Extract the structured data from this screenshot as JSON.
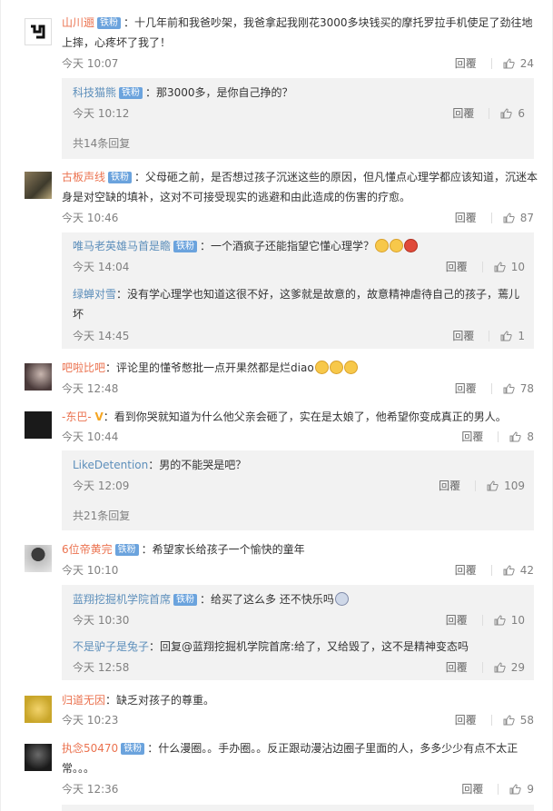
{
  "comments": [
    {
      "name": "山川逦",
      "badge": "铁粉",
      "text": "：十几年前和我爸吵架，我爸拿起我刚花3000多块钱买的摩托罗拉手机使足了劲往地上摔，心疼坏了我了！",
      "time": "今天 10:07",
      "reply_label": "回覆",
      "likes": "24",
      "replies": [
        {
          "name": "科技猫熊",
          "badge": "铁粉",
          "text": "：那3000多，是你自己挣的？",
          "time": "今天 10:12",
          "reply_label": "回覆",
          "likes": "6"
        }
      ],
      "more": "共14条回复"
    },
    {
      "name": "古板声线",
      "badge": "铁粉",
      "text": "：父母砸之前，是否想过孩子沉迷这些的原因，但凡懂点心理学都应该知道，沉迷本身是对空缺的填补，这对不可接受现实的逃避和由此造成的伤害的疗愈。",
      "time": "今天 10:46",
      "reply_label": "回覆",
      "likes": "87",
      "replies": [
        {
          "name": "唯马老英雄马首是瞻",
          "badge": "铁粉",
          "text": "：一个酒疯子还能指望它懂心理学？",
          "time": "今天 14:04",
          "reply_label": "回覆",
          "likes": "10"
        },
        {
          "name": "绿蝉对雪",
          "badge": "",
          "text": "：没有学心理学也知道这很不好，这爹就是故意的，故意精神虐待自己的孩子，蔫儿坏",
          "time": "今天 14:45",
          "reply_label": "回覆",
          "likes": "1"
        }
      ],
      "more": ""
    },
    {
      "name": "吧啦比吧",
      "badge": "",
      "text": "：评论里的懂爷憋批一点开果然都是烂diao",
      "time": "今天 12:48",
      "reply_label": "回覆",
      "likes": "78",
      "replies": [],
      "more": ""
    },
    {
      "name": "-东巴-",
      "badge": "V",
      "text": "：看到你哭就知道为什么他父亲会砸了，实在是太娘了，他希望你变成真正的男人。",
      "time": "今天 10:44",
      "reply_label": "回覆",
      "likes": "8",
      "replies": [
        {
          "name": "LikeDetention",
          "badge": "",
          "text": "：男的不能哭是吧？",
          "time": "今天 12:09",
          "reply_label": "回覆",
          "likes": "109"
        }
      ],
      "more": "共21条回复"
    },
    {
      "name": "6位帝黄完",
      "badge": "铁粉",
      "text": "：希望家长给孩子一个愉快的童年",
      "time": "今天 10:10",
      "reply_label": "回覆",
      "likes": "42",
      "replies": [
        {
          "name": "蓝翔挖掘机学院首席",
          "badge": "铁粉",
          "text": "：给买了这么多 还不快乐吗",
          "time": "今天 10:30",
          "reply_label": "回覆",
          "likes": "10"
        },
        {
          "name": "不是驴子是兔子",
          "badge": "",
          "text": "：回复@蓝翔挖掘机学院首席:给了，又给毁了，这不是精神变态吗",
          "time": "今天 12:58",
          "reply_label": "回覆",
          "likes": "29"
        }
      ],
      "more": ""
    },
    {
      "name": "归道无因",
      "badge": "",
      "text": "：缺乏对孩子的尊重。",
      "time": "今天 10:23",
      "reply_label": "回覆",
      "likes": "58",
      "replies": [],
      "more": ""
    },
    {
      "name": "执念50470",
      "badge": "铁粉",
      "text": "：什么漫圈。。手办圈。。反正跟动漫沾边圈子里面的人，多多少少有点不太正常。。。",
      "time": "今天 12:36",
      "reply_label": "回覆",
      "likes": "9",
      "replies": [],
      "more": ""
    }
  ],
  "colors": {
    "username": "#eb7350",
    "reply_username": "#5d8fbb",
    "badge_bg": "#6ba3dd",
    "reply_box_bg": "#f2f2f2"
  }
}
